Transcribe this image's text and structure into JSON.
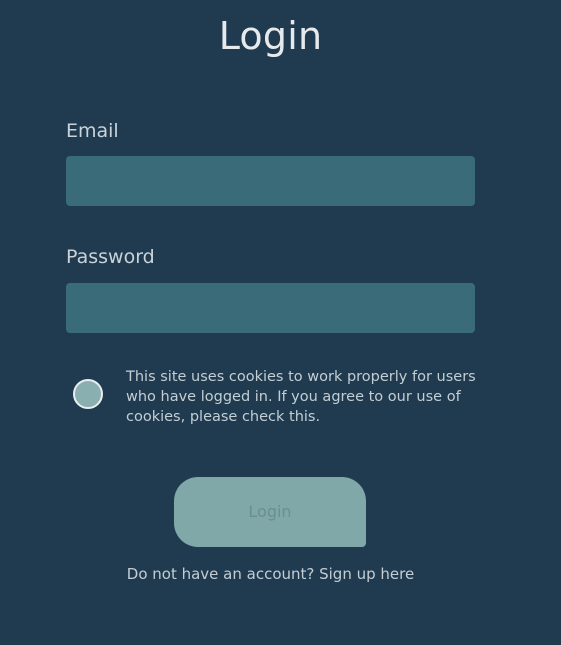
{
  "page": {
    "title": "Login"
  },
  "form": {
    "email_label": "Email",
    "email_value": "",
    "password_label": "Password",
    "password_value": "",
    "consent_text": "This site uses cookies to work properly for users who have logged in. If you agree to our use of cookies, please check this.",
    "consent_checked": false,
    "login_button": "Login",
    "signup_link": "Do not have an account? Sign up here"
  },
  "colors": {
    "background": "#203b4f",
    "input_fill": "#396b78",
    "button_fill": "#80a8a8",
    "radio_fill": "#8aafb0"
  }
}
